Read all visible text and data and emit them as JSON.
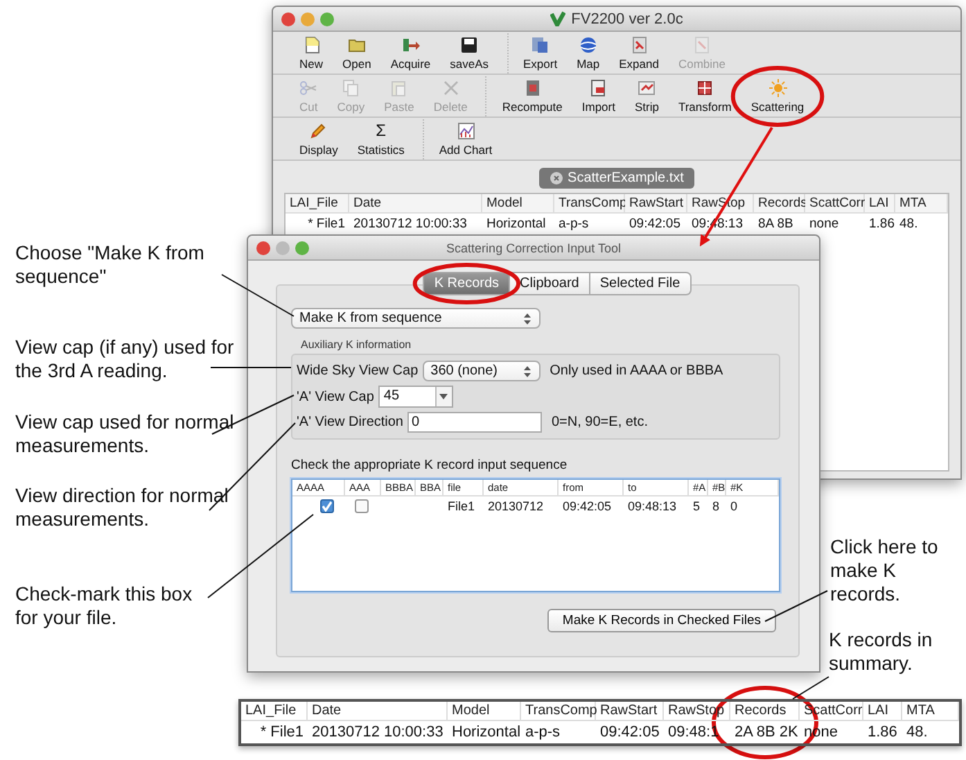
{
  "main_window": {
    "title": "FV2200 ver 2.0c",
    "toolbars": [
      {
        "groups": [
          [
            {
              "label": "New",
              "disabled": false
            },
            {
              "label": "Open",
              "disabled": false
            },
            {
              "label": "Acquire",
              "disabled": false
            },
            {
              "label": "saveAs",
              "disabled": false
            }
          ],
          [
            {
              "label": "Export",
              "disabled": false
            },
            {
              "label": "Map",
              "disabled": false
            },
            {
              "label": "Expand",
              "disabled": false
            },
            {
              "label": "Combine",
              "disabled": true
            }
          ]
        ]
      },
      {
        "groups": [
          [
            {
              "label": "Cut",
              "disabled": true
            },
            {
              "label": "Copy",
              "disabled": true
            },
            {
              "label": "Paste",
              "disabled": true
            },
            {
              "label": "Delete",
              "disabled": true
            }
          ],
          [
            {
              "label": "Recompute",
              "disabled": false
            },
            {
              "label": "Import",
              "disabled": false
            },
            {
              "label": "Strip",
              "disabled": false
            },
            {
              "label": "Transform",
              "disabled": false
            },
            {
              "label": "Scattering",
              "disabled": false
            }
          ]
        ]
      },
      {
        "groups": [
          [
            {
              "label": "Display",
              "disabled": false
            },
            {
              "label": "Statistics",
              "disabled": false,
              "glyph": "Σ"
            }
          ],
          [
            {
              "label": "Add Chart",
              "disabled": false
            }
          ]
        ]
      }
    ],
    "document_tab": "ScatterExample.txt",
    "table": {
      "columns": [
        "LAI_File",
        "Date",
        "Model",
        "TransComp",
        "RawStart",
        "RawStop",
        "Records",
        "ScattCorr",
        "LAI",
        "MTA"
      ],
      "rows": [
        [
          "* File1",
          "20130712 10:00:33",
          "Horizontal",
          "a-p-s",
          "09:42:05",
          "09:48:13",
          "8A 8B",
          "none",
          "1.86",
          "48."
        ]
      ]
    }
  },
  "dialog": {
    "title": "Scattering Correction Input Tool",
    "tabs": [
      {
        "label": "K Records",
        "selected": true
      },
      {
        "label": "Clipboard",
        "selected": false
      },
      {
        "label": "Selected File",
        "selected": false
      }
    ],
    "mode_select": "Make K from sequence",
    "aux_title": "Auxiliary K information",
    "fields": [
      {
        "kind": "select",
        "label": "Wide Sky View Cap",
        "value": "360 (none)",
        "note": "Only used in AAAA or BBBA"
      },
      {
        "kind": "combo",
        "label": "'A' View Cap",
        "value": "45"
      },
      {
        "kind": "text",
        "label": "'A' View Direction",
        "value": "0",
        "note": "0=N, 90=E, etc."
      }
    ],
    "list_title": "Check the appropriate K record input sequence",
    "list": {
      "columns": [
        "AAAA",
        "AAA",
        "BBBA",
        "BBA",
        "file",
        "date",
        "from",
        "to",
        "#A",
        "#B",
        "#K"
      ],
      "rows": [
        {
          "checks": [
            true,
            false
          ],
          "cells": [
            "",
            "",
            "",
            "",
            "File1",
            "20130712",
            "09:42:05",
            "09:48:13",
            "5",
            "8",
            "0"
          ]
        }
      ]
    },
    "button": "Make K Records in Checked Files"
  },
  "callouts": [
    {
      "text": "Choose \"Make K from sequence\""
    },
    {
      "text": "View cap (if any) used for the 3rd A reading."
    },
    {
      "text": "View cap used for normal measurements."
    },
    {
      "text": "View direction for normal measurements."
    },
    {
      "text": "Check-mark this box for your file."
    },
    {
      "text": "Click here to make K records."
    },
    {
      "text": "K records in summary."
    }
  ],
  "summary_table": {
    "columns": [
      "LAI_File",
      "Date",
      "Model",
      "TransComp",
      "RawStart",
      "RawStop",
      "Records",
      "ScattCorr",
      "LAI",
      "MTA"
    ],
    "rows": [
      [
        "* File1",
        "20130712 10:00:33",
        "Horizontal",
        "a-p-s",
        "09:42:05",
        "09:48:1",
        "2A 8B 2K",
        "none",
        "1.86",
        "48."
      ]
    ]
  }
}
